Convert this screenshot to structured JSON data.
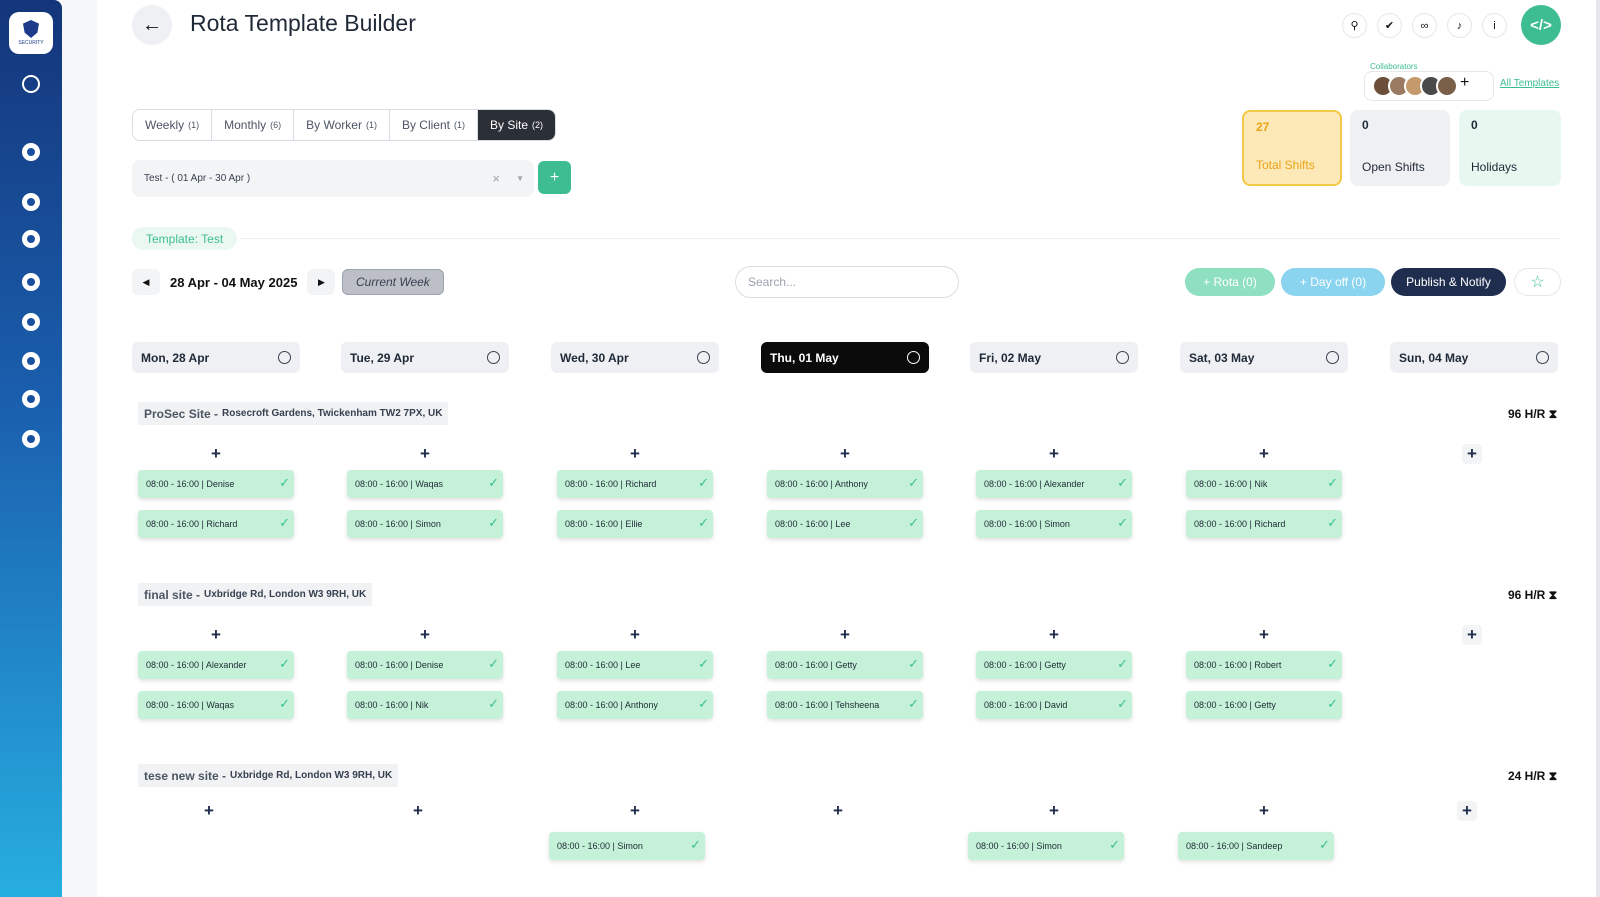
{
  "header": {
    "title": "Rota Template Builder",
    "back_icon": "←"
  },
  "sidebar": {
    "logo_text": "SECURITY"
  },
  "top_icons": [
    "search-icon",
    "check-circle-icon",
    "link-icon",
    "bell-icon",
    "info-icon"
  ],
  "collaborators": {
    "label": "Collaborators",
    "count": 5,
    "add": "+",
    "all_templates": "All Templates"
  },
  "stats": {
    "total": {
      "value": "27",
      "label": "Total Shifts"
    },
    "open": {
      "value": "0",
      "label": "Open Shifts"
    },
    "holidays": {
      "value": "0",
      "label": "Holidays"
    }
  },
  "tabs": [
    {
      "label": "Weekly",
      "count": "(1)"
    },
    {
      "label": "Monthly",
      "count": "(6)"
    },
    {
      "label": "By Worker",
      "count": "(1)"
    },
    {
      "label": "By Client",
      "count": "(1)"
    },
    {
      "label": "By Site",
      "count": "(2)",
      "active": true
    }
  ],
  "template_select": {
    "value": "Test - ( 01 Apr - 30 Apr )",
    "clear": "×",
    "add": "+"
  },
  "template_chip": "Template: Test",
  "week_nav": {
    "range": "28 Apr - 04 May 2025",
    "current_week": "Current Week"
  },
  "search": {
    "placeholder": "Search..."
  },
  "actions": {
    "rota": "+ Rota (0)",
    "day_off": "+ Day off (0)",
    "publish": "Publish & Notify",
    "star": "☆"
  },
  "days": [
    "Mon, 28 Apr",
    "Tue, 29 Apr",
    "Wed, 30 Apr",
    "Thu, 01 May",
    "Fri, 02 May",
    "Sat, 03 May",
    "Sun, 04 May"
  ],
  "today_index": 3,
  "sites": [
    {
      "name": "ProSec Site -",
      "address": "Rosecroft Gardens, Twickenham TW2 7PX, UK",
      "hours": "96 H/R",
      "shifts": [
        [
          "08:00 - 16:00 | Denise",
          "08:00 - 16:00 | Richard"
        ],
        [
          "08:00 - 16:00 | Waqas",
          "08:00 - 16:00 | Simon"
        ],
        [
          "08:00 - 16:00 | Richard",
          "08:00 - 16:00 | Ellie"
        ],
        [
          "08:00 - 16:00 | Anthony",
          "08:00 - 16:00 | Lee"
        ],
        [
          "08:00 - 16:00 | Alexander",
          "08:00 - 16:00 | Simon"
        ],
        [
          "08:00 - 16:00 | Nik",
          "08:00 - 16:00 | Richard"
        ],
        []
      ]
    },
    {
      "name": "final site -",
      "address": "Uxbridge Rd, London W3 9RH, UK",
      "hours": "96 H/R",
      "shifts": [
        [
          "08:00 - 16:00 | Alexander",
          "08:00 - 16:00 | Waqas"
        ],
        [
          "08:00 - 16:00 | Denise",
          "08:00 - 16:00 | Nik"
        ],
        [
          "08:00 - 16:00 | Lee",
          "08:00 - 16:00 | Anthony"
        ],
        [
          "08:00 - 16:00 | Getty",
          "08:00 - 16:00 | Tehsheena"
        ],
        [
          "08:00 - 16:00 | Getty",
          "08:00 - 16:00 | David"
        ],
        [
          "08:00 - 16:00 | Robert",
          "08:00 - 16:00 | Getty"
        ],
        []
      ]
    },
    {
      "name": "tese new site -",
      "address": "Uxbridge Rd, London W3 9RH, UK",
      "hours": "24 H/R",
      "shifts": [
        [],
        [],
        [
          "08:00 - 16:00 | Simon"
        ],
        [],
        [
          "08:00 - 16:00 | Simon"
        ],
        [
          "08:00 - 16:00 | Sandeep"
        ],
        []
      ]
    }
  ],
  "colors": {
    "accent": "#3ebd93",
    "shift_bg": "#c4f1d7",
    "sidebar_top": "#14357a",
    "sidebar_bottom": "#27aee0",
    "publish": "#1f2d4e"
  }
}
